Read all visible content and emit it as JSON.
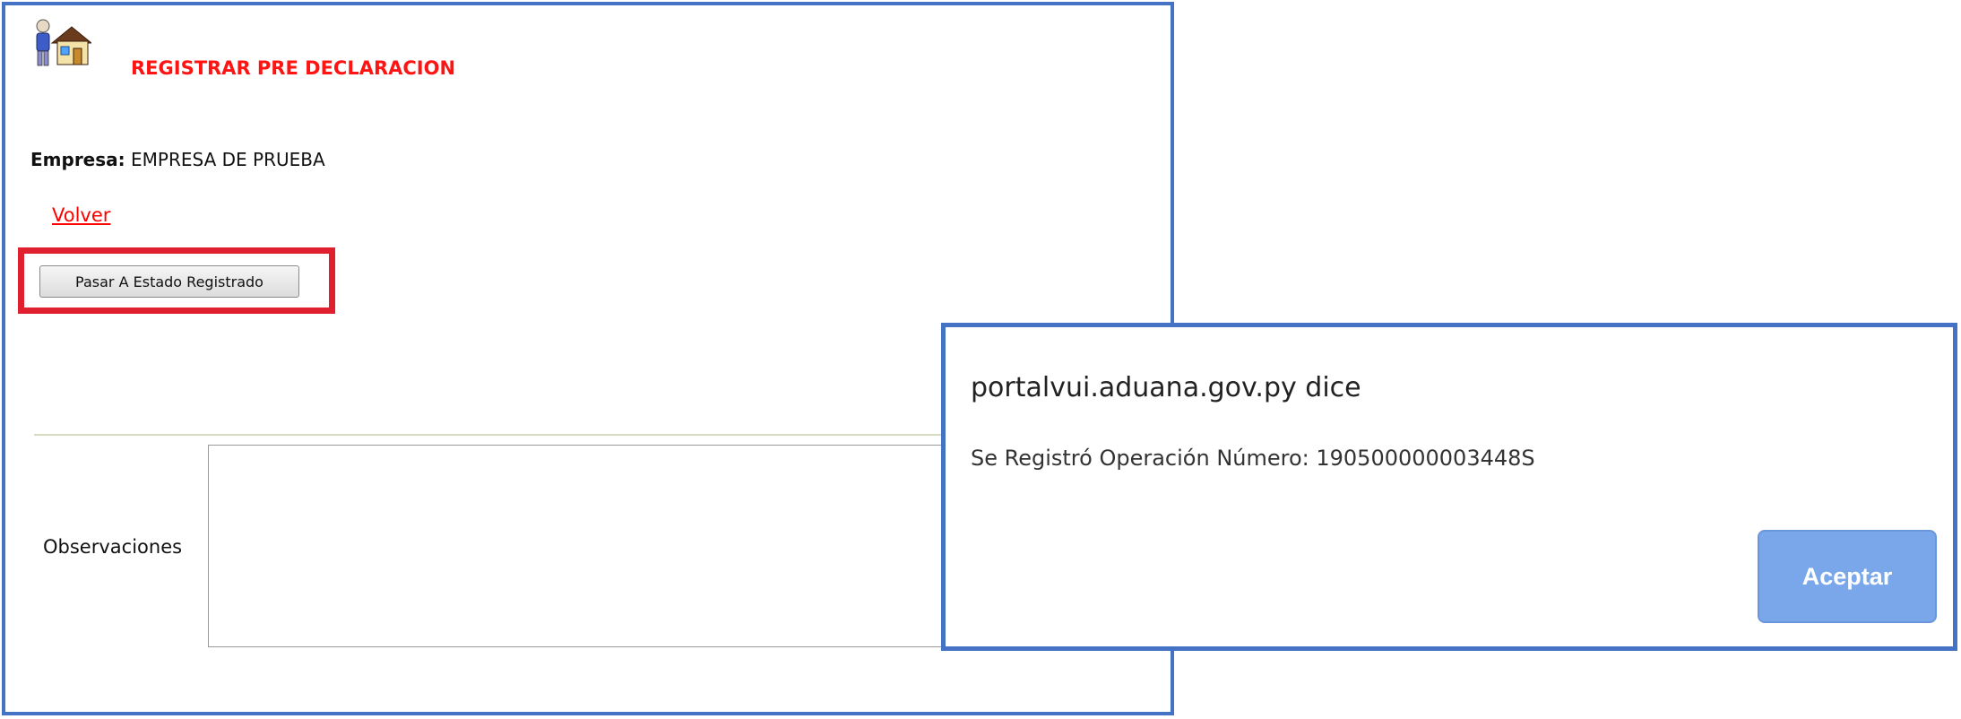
{
  "page": {
    "title": "REGISTRAR PRE DECLARACION",
    "empresa_label": "Empresa:",
    "empresa_value": "EMPRESA DE PRUEBA",
    "back_link": "Volver",
    "state_button": "Pasar A Estado Registrado",
    "observaciones_label": "Observaciones",
    "observaciones_value": ""
  },
  "dialog": {
    "origin": "portalvui.aduana.gov.py dice",
    "message": "Se Registró Operación Número: 190500000003448S",
    "accept_button": "Aceptar"
  },
  "icons": {
    "logo": "user-house-icon"
  },
  "colors": {
    "frame_border": "#4472c4",
    "title": "#ff1414",
    "link": "#ff0000",
    "highlight": "#e0202f",
    "accept_button": "#7aa7ea"
  }
}
